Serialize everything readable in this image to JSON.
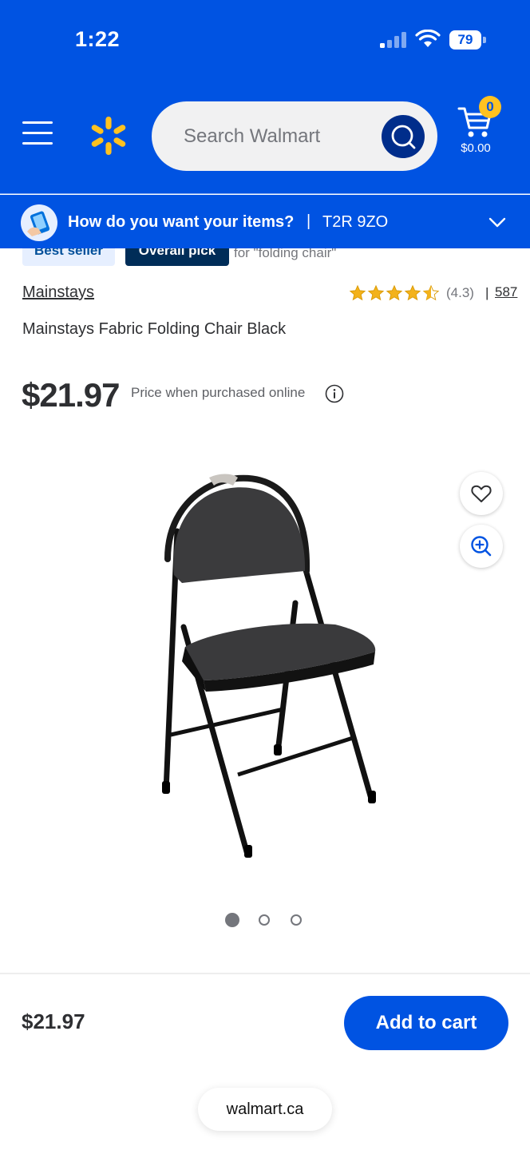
{
  "status_bar": {
    "time": "1:22",
    "battery": "79",
    "signal_icon": "cellular-signal-icon",
    "wifi_icon": "wifi-icon"
  },
  "header": {
    "menu_icon": "hamburger-menu-icon",
    "logo_icon": "walmart-spark-logo",
    "search_placeholder": "Search Walmart",
    "search_icon": "search-icon",
    "cart_icon": "cart-icon",
    "cart_count": "0",
    "cart_total": "$0.00",
    "colors": {
      "primary": "#0053e2",
      "spark": "#ffc220",
      "search_button": "#002d8b"
    }
  },
  "delivery_bar": {
    "question": "How do you want your items?",
    "separator": "|",
    "postal_code": "T2R 9ZO",
    "chevron_icon": "chevron-down-icon"
  },
  "badges": {
    "best_seller": "Best seller",
    "overall_pick": "Overall pick",
    "overall_pick_for": "for \"folding chair\""
  },
  "product": {
    "brand": "Mainstays",
    "rating": 4.3,
    "rating_text": "(4.3)",
    "rating_separator": "|",
    "review_count": "587",
    "title": "Mainstays Fabric Folding Chair Black",
    "price": "$21.97",
    "price_note": "Price when purchased online",
    "info_icon": "info-icon",
    "image_count": 3,
    "active_image": 1,
    "favorite_icon": "heart-icon",
    "zoom_icon": "zoom-in-icon"
  },
  "footer": {
    "price": "$21.97",
    "add_to_cart": "Add to cart",
    "url": "walmart.ca"
  }
}
